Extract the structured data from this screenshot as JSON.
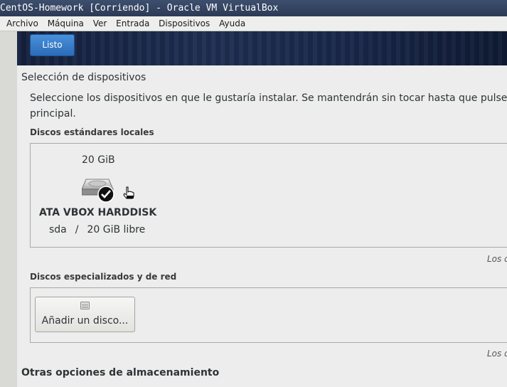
{
  "window": {
    "title": "CentOS-Homework [Corriendo] - Oracle VM VirtualBox"
  },
  "menubar": {
    "items": [
      "Archivo",
      "Máquina",
      "Ver",
      "Entrada",
      "Dispositivos",
      "Ayuda"
    ]
  },
  "header": {
    "done_label": "Listo"
  },
  "section": {
    "title": "Selección de dispositivos",
    "description_line1": "Seleccione los dispositivos en que le gustaría instalar. Se mantendrán sin tocar hasta que pulse e",
    "description_line2": "principal."
  },
  "local_disks": {
    "title": "Discos estándares locales",
    "disk": {
      "size": "20 GiB",
      "name": "ATA VBOX HARDDISK",
      "device": "sda",
      "separator": "/",
      "free": "20 GiB libre",
      "selected": true
    },
    "note": "Los d"
  },
  "specialized_disks": {
    "title": "Discos especializados y de red",
    "add_button_label": "Añadir un disco...",
    "note": "Los d"
  },
  "other_options": {
    "title": "Otras opciones de almacenamiento"
  }
}
